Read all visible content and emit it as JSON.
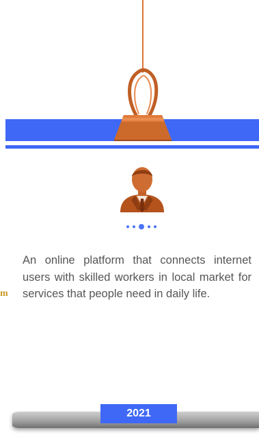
{
  "timeline": {
    "description": "An online platform that connects internet users with skilled workers in local market for services that people need in daily life.",
    "year": "2021",
    "pager": {
      "count": 5,
      "active_index": 2
    },
    "side_logo": "m"
  },
  "colors": {
    "accent_blue": "#3f68f6",
    "clip_orange": "#cc6a2c",
    "text_gray": "#555555"
  },
  "icons": [
    "binder-clip-icon",
    "businessman-avatar-icon"
  ]
}
